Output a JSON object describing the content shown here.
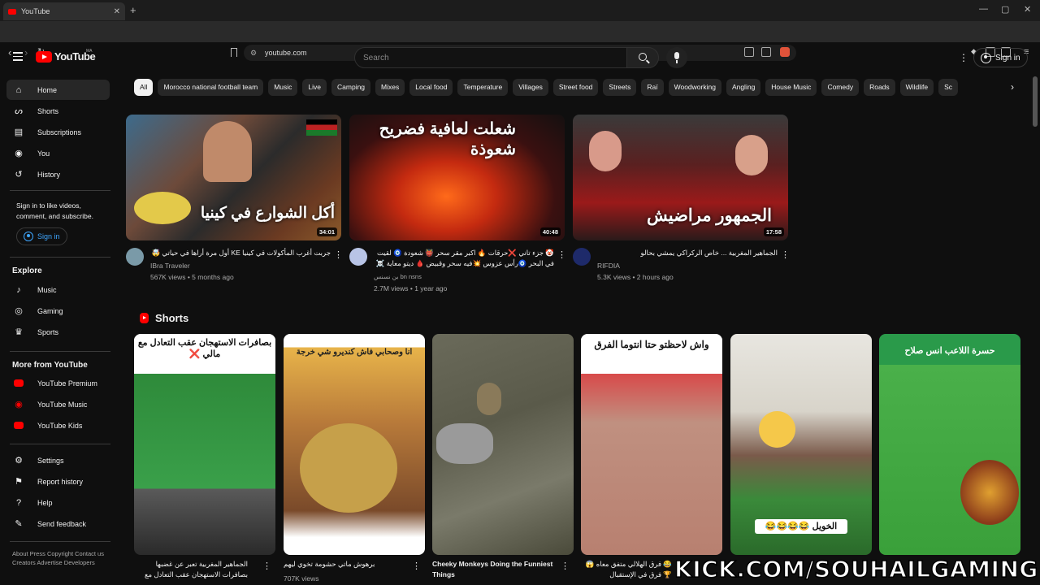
{
  "browser": {
    "tab_title": "YouTube",
    "url": "youtube.com"
  },
  "header": {
    "logo_text": "YouTube",
    "country_code": "MA",
    "search_placeholder": "Search",
    "signin_label": "Sign in"
  },
  "sidebar": {
    "main": [
      {
        "label": "Home",
        "icon": "home-icon",
        "active": true
      },
      {
        "label": "Shorts",
        "icon": "shorts-icon"
      },
      {
        "label": "Subscriptions",
        "icon": "subscriptions-icon"
      },
      {
        "label": "You",
        "icon": "you-icon"
      },
      {
        "label": "History",
        "icon": "history-icon"
      }
    ],
    "signin_prompt": "Sign in to like videos, comment, and subscribe.",
    "signin_label": "Sign in",
    "explore_heading": "Explore",
    "explore": [
      {
        "label": "Music",
        "icon": "music-icon"
      },
      {
        "label": "Gaming",
        "icon": "gaming-icon"
      },
      {
        "label": "Sports",
        "icon": "sports-icon"
      }
    ],
    "more_heading": "More from YouTube",
    "more": [
      {
        "label": "YouTube Premium"
      },
      {
        "label": "YouTube Music"
      },
      {
        "label": "YouTube Kids"
      }
    ],
    "settings": [
      {
        "label": "Settings",
        "icon": "gear-icon"
      },
      {
        "label": "Report history",
        "icon": "flag-icon"
      },
      {
        "label": "Help",
        "icon": "help-icon"
      },
      {
        "label": "Send feedback",
        "icon": "feedback-icon"
      }
    ],
    "footer": "About  Press  Copyright  Contact us  Creators  Advertise  Developers"
  },
  "chips": [
    "All",
    "Morocco national football team",
    "Music",
    "Live",
    "Camping",
    "Mixes",
    "Local food",
    "Temperature",
    "Villages",
    "Street food",
    "Streets",
    "Raï",
    "Woodworking",
    "Angling",
    "House Music",
    "Comedy",
    "Roads",
    "Wildlife",
    "Sc"
  ],
  "videos": [
    {
      "title": "جربت أغرب المأكولات في كينيا KE أول مرة أراها في حياتي 🤯",
      "channel": "IBra Traveler",
      "meta": "567K views • 5 months ago",
      "duration": "34:01",
      "overlay": "أكل الشوارع في كينيا"
    },
    {
      "title": "🤡 جزء تاني ❌حرقات 🔥 اكبر مقر سحر 👹 شعودة 🧿 لقيت في البحر 🧿رأس عزوس 💥فيه سحر وقبيض 🩸 ديتو معاية ☠️ لدار",
      "channel": "بن نسنس bn nsns",
      "meta": "2.7M views • 1 year ago",
      "duration": "40:48",
      "overlay": "شعلت لعافية فضريح شعوذة"
    },
    {
      "title": "الجماهير المغربية ... خاص الركراكي يمشي بحالو",
      "channel": "RIFDIA",
      "meta": "5.3K views • 2 hours ago",
      "duration": "17:58",
      "overlay": "الجمهور مراضيش"
    }
  ],
  "shorts": {
    "heading": "Shorts",
    "items": [
      {
        "title": "الجماهير المغربية تعبر عن غضبها بصافرات الاستهجان عقب التعادل مع مالي ❌",
        "views": "",
        "caption": "بصافرات الاستهجان عقب التعادل مع مالي ❌"
      },
      {
        "title": "برهوش ماتي حشومة تخوي ليهم",
        "views": "707K views",
        "caption": "انا وصحابي فاش كنديرو شي خرجة"
      },
      {
        "title": "Cheeky Monkeys Doing the Funniest Things",
        "views": "",
        "caption": ""
      },
      {
        "title": "😂 فرق الهلالي متفق معاه 😱 🏆 فرق في الإستقبال #كأس_إفريقيا_المغرب",
        "views": "",
        "caption": "واش لاحظتو حتا انتوما الفرق"
      },
      {
        "title": "",
        "views": "",
        "caption": "الخويل 😂😂😂😂"
      },
      {
        "title": "",
        "views": "",
        "caption": "حسرة اللاعب انس صلاح"
      }
    ]
  },
  "watermark": "KICK.COM/SOUHAILGAMING"
}
